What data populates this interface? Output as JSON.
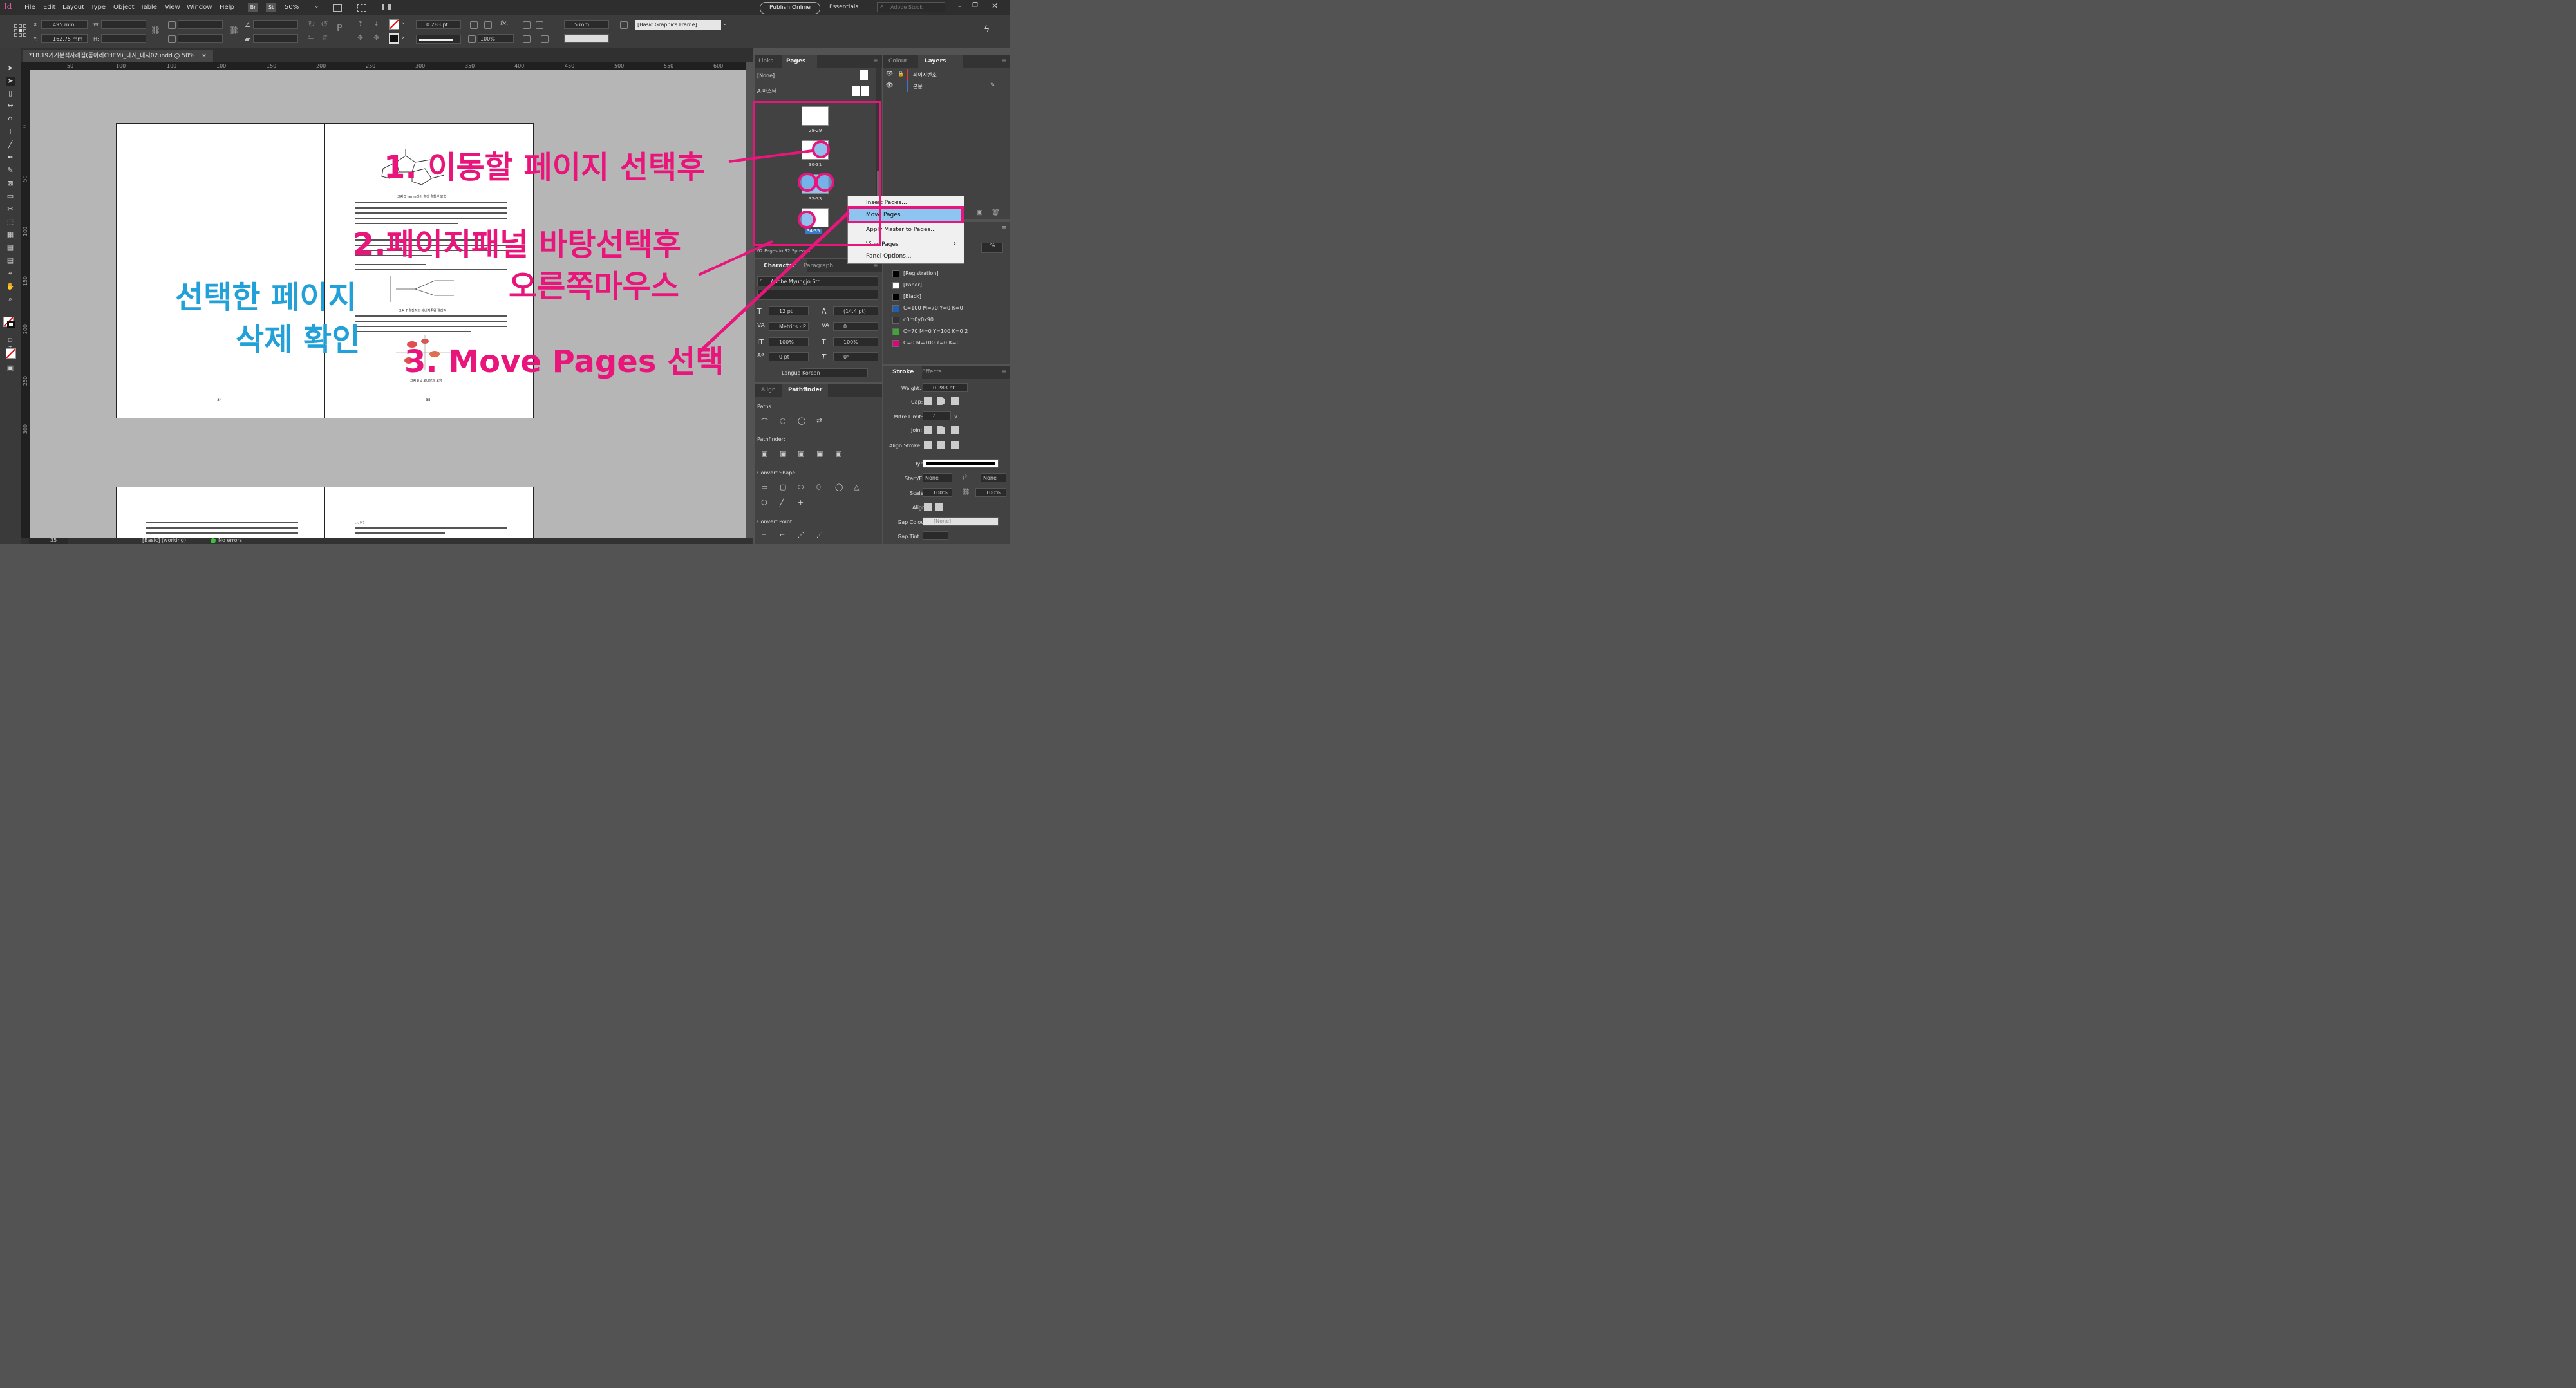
{
  "app": {
    "logo": "Id"
  },
  "menu": [
    "File",
    "Edit",
    "Layout",
    "Type",
    "Object",
    "Table",
    "View",
    "Window",
    "Help"
  ],
  "appbar": {
    "bridge_badge": "Br",
    "stock_badge": "St",
    "zoom": "50%",
    "publish_online": "Publish Online",
    "workspace": "Essentials",
    "stock_search_placeholder": "Adobe Stock"
  },
  "control": {
    "x_label": "X:",
    "x_value": "495 mm",
    "y_label": "Y:",
    "y_value": "162.75 mm",
    "w_label": "W:",
    "h_label": "H:",
    "stroke_weight": "0.283 pt",
    "offset_value": "5 mm",
    "scale_value": "100%",
    "object_style": "[Basic Graphics Frame]"
  },
  "document_tab": {
    "title": "*18.19기기분석사례집(동아리CHEM)_내지_내지02.indd @ 50%",
    "close": "×"
  },
  "ruler": {
    "h_marks": [
      "50",
      "50",
      "100",
      "150",
      "200",
      "250",
      "300",
      "350",
      "400",
      "450",
      "500",
      "550",
      "600"
    ],
    "v_marks": [
      "0",
      "50",
      "100",
      "150",
      "200",
      "250",
      "300"
    ]
  },
  "pages": {
    "left_number": "- 34 -",
    "right_number": "- 35 -",
    "fig_caption_1": "그림 5 heme이이 철이 결합된 모형",
    "fig_caption_2": "그림 7 결정장의 에너지준위 갈라짐",
    "fig_caption_3": "그림 8 d 오비탈의 모양",
    "lower_right_head": "나. 이?"
  },
  "pages_panel": {
    "tabs": [
      "Links",
      "Pages"
    ],
    "none_master": "[None]",
    "a_master": "A-마스터",
    "thumb_labels": [
      "28-29",
      "30-31",
      "32-33",
      "34-35"
    ],
    "footer": "62 Pages in 32 Spreads"
  },
  "context_menu": {
    "items": [
      "Insert Pages...",
      "Move Pages...",
      "Apply Master to Pages...",
      "View Pages",
      "Panel Options..."
    ],
    "submenu_arrow": "›"
  },
  "layers_panel": {
    "tabs": [
      "Colour",
      "Layers"
    ],
    "layers": [
      "페이지번호",
      "본문"
    ]
  },
  "character_panel": {
    "tabs": [
      "Character",
      "Paragraph"
    ],
    "font": "Adobe Myungjo Std",
    "size": "12 pt",
    "leading": "(14.4 pt)",
    "kerning": "Metrics - P",
    "tracking": "0",
    "v_scale": "100%",
    "h_scale": "100%",
    "baseline": "0 pt",
    "skew": "0°",
    "language_label": "Language:",
    "language": "Korean"
  },
  "swatches": {
    "percent_label": "%",
    "items": [
      {
        "name": "[Registration]",
        "color": "#000000"
      },
      {
        "name": "[Paper]",
        "color": "#ffffff"
      },
      {
        "name": "[Black]",
        "color": "#000000"
      },
      {
        "name": "C=100 M=70 Y=0 K=0",
        "color": "#1f5fb3"
      },
      {
        "name": "c0m0y0k90",
        "color": "#333333"
      },
      {
        "name": "C=70 M=0 Y=100 K=0 2",
        "color": "#3fa535"
      },
      {
        "name": "C=0 M=100 Y=0 K=0",
        "color": "#e6007e"
      }
    ]
  },
  "pathfinder": {
    "tabs": [
      "Align",
      "Pathfinder"
    ],
    "paths_label": "Paths:",
    "pathfinder_label": "Pathfinder:",
    "convert_shape_label": "Convert Shape:",
    "convert_point_label": "Convert Point:"
  },
  "stroke_panel": {
    "tabs": [
      "Stroke",
      "Effects"
    ],
    "weight_label": "Weight:",
    "weight": "0.283 pt",
    "cap_label": "Cap:",
    "mitre_label": "Mitre Limit:",
    "mitre": "4",
    "mitre_unit": "x",
    "join_label": "Join:",
    "align_label": "Align Stroke:",
    "type_label": "Type:",
    "startend_label": "Start/End:",
    "start": "None",
    "end": "None",
    "scale_label": "Scale:",
    "scale_start": "100%",
    "scale_end": "100%",
    "align2_label": "Align:",
    "gapcolour_label": "Gap Colour:",
    "gapcolour": "[None]",
    "gaptint_label": "Gap Tint:"
  },
  "status": {
    "page": "35",
    "master": "[Basic] (working)",
    "errors": "No errors"
  },
  "annotations": {
    "step1": "1. 이동할  페이지 선택후",
    "step2": "2.페이지패널 바탕선택후",
    "step2b": "오른쪽마우스",
    "step3": "3. Move Pages 선택",
    "confirm1": "선택한 페이지",
    "confirm2": "삭제 확인"
  },
  "colors": {
    "accent": "#e8157b",
    "blue_note": "#22a0d8",
    "menu_highlight": "#8ec5f0"
  }
}
